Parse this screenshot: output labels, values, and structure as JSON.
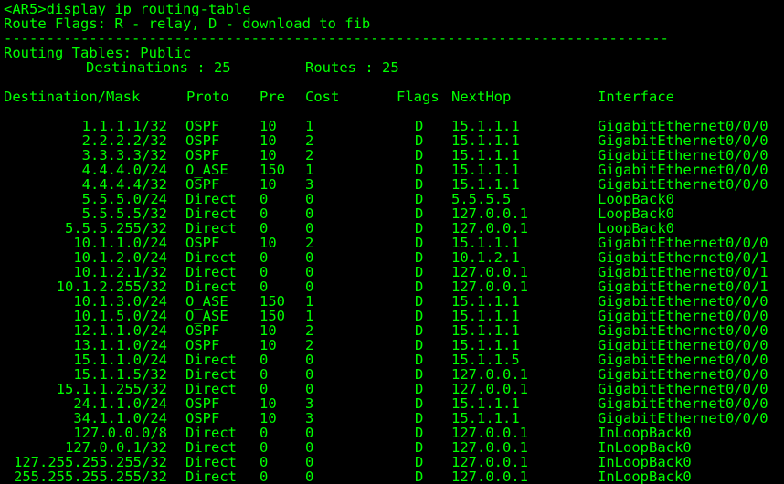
{
  "theme": {
    "background": "#000000",
    "text_color": "#00ff00"
  },
  "terminal": {
    "prompt_command": "<AR5>display ip routing-table",
    "flags_legend": "Route Flags: R - relay, D - download to fib",
    "separator": "------------------------------------------------------------------------------",
    "routing_tables_label": "Routing Tables: Public",
    "destinations_label": "Destinations : 25",
    "routes_label": "Routes : 25",
    "headers": {
      "destination": "Destination/Mask",
      "proto": "Proto",
      "pre": "Pre",
      "cost": "Cost",
      "flags": "Flags",
      "nexthop": "NextHop",
      "interface": "Interface"
    },
    "rows": [
      {
        "dest": "1.1.1.1/32",
        "proto": "OSPF",
        "pre": "10",
        "cost": "1",
        "flags": "D",
        "nexthop": "15.1.1.1",
        "iface": "GigabitEthernet0/0/0"
      },
      {
        "dest": "2.2.2.2/32",
        "proto": "OSPF",
        "pre": "10",
        "cost": "2",
        "flags": "D",
        "nexthop": "15.1.1.1",
        "iface": "GigabitEthernet0/0/0"
      },
      {
        "dest": "3.3.3.3/32",
        "proto": "OSPF",
        "pre": "10",
        "cost": "2",
        "flags": "D",
        "nexthop": "15.1.1.1",
        "iface": "GigabitEthernet0/0/0"
      },
      {
        "dest": "4.4.4.0/24",
        "proto": "O_ASE",
        "pre": "150",
        "cost": "1",
        "flags": "D",
        "nexthop": "15.1.1.1",
        "iface": "GigabitEthernet0/0/0"
      },
      {
        "dest": "4.4.4.4/32",
        "proto": "OSPF",
        "pre": "10",
        "cost": "3",
        "flags": "D",
        "nexthop": "15.1.1.1",
        "iface": "GigabitEthernet0/0/0"
      },
      {
        "dest": "5.5.5.0/24",
        "proto": "Direct",
        "pre": "0",
        "cost": "0",
        "flags": "D",
        "nexthop": "5.5.5.5",
        "iface": "LoopBack0"
      },
      {
        "dest": "5.5.5.5/32",
        "proto": "Direct",
        "pre": "0",
        "cost": "0",
        "flags": "D",
        "nexthop": "127.0.0.1",
        "iface": "LoopBack0"
      },
      {
        "dest": "5.5.5.255/32",
        "proto": "Direct",
        "pre": "0",
        "cost": "0",
        "flags": "D",
        "nexthop": "127.0.0.1",
        "iface": "LoopBack0"
      },
      {
        "dest": "10.1.1.0/24",
        "proto": "OSPF",
        "pre": "10",
        "cost": "2",
        "flags": "D",
        "nexthop": "15.1.1.1",
        "iface": "GigabitEthernet0/0/0"
      },
      {
        "dest": "10.1.2.0/24",
        "proto": "Direct",
        "pre": "0",
        "cost": "0",
        "flags": "D",
        "nexthop": "10.1.2.1",
        "iface": "GigabitEthernet0/0/1"
      },
      {
        "dest": "10.1.2.1/32",
        "proto": "Direct",
        "pre": "0",
        "cost": "0",
        "flags": "D",
        "nexthop": "127.0.0.1",
        "iface": "GigabitEthernet0/0/1"
      },
      {
        "dest": "10.1.2.255/32",
        "proto": "Direct",
        "pre": "0",
        "cost": "0",
        "flags": "D",
        "nexthop": "127.0.0.1",
        "iface": "GigabitEthernet0/0/1"
      },
      {
        "dest": "10.1.3.0/24",
        "proto": "O_ASE",
        "pre": "150",
        "cost": "1",
        "flags": "D",
        "nexthop": "15.1.1.1",
        "iface": "GigabitEthernet0/0/0"
      },
      {
        "dest": "10.1.5.0/24",
        "proto": "O_ASE",
        "pre": "150",
        "cost": "1",
        "flags": "D",
        "nexthop": "15.1.1.1",
        "iface": "GigabitEthernet0/0/0"
      },
      {
        "dest": "12.1.1.0/24",
        "proto": "OSPF",
        "pre": "10",
        "cost": "2",
        "flags": "D",
        "nexthop": "15.1.1.1",
        "iface": "GigabitEthernet0/0/0"
      },
      {
        "dest": "13.1.1.0/24",
        "proto": "OSPF",
        "pre": "10",
        "cost": "2",
        "flags": "D",
        "nexthop": "15.1.1.1",
        "iface": "GigabitEthernet0/0/0"
      },
      {
        "dest": "15.1.1.0/24",
        "proto": "Direct",
        "pre": "0",
        "cost": "0",
        "flags": "D",
        "nexthop": "15.1.1.5",
        "iface": "GigabitEthernet0/0/0"
      },
      {
        "dest": "15.1.1.5/32",
        "proto": "Direct",
        "pre": "0",
        "cost": "0",
        "flags": "D",
        "nexthop": "127.0.0.1",
        "iface": "GigabitEthernet0/0/0"
      },
      {
        "dest": "15.1.1.255/32",
        "proto": "Direct",
        "pre": "0",
        "cost": "0",
        "flags": "D",
        "nexthop": "127.0.0.1",
        "iface": "GigabitEthernet0/0/0"
      },
      {
        "dest": "24.1.1.0/24",
        "proto": "OSPF",
        "pre": "10",
        "cost": "3",
        "flags": "D",
        "nexthop": "15.1.1.1",
        "iface": "GigabitEthernet0/0/0"
      },
      {
        "dest": "34.1.1.0/24",
        "proto": "OSPF",
        "pre": "10",
        "cost": "3",
        "flags": "D",
        "nexthop": "15.1.1.1",
        "iface": "GigabitEthernet0/0/0"
      },
      {
        "dest": "127.0.0.0/8",
        "proto": "Direct",
        "pre": "0",
        "cost": "0",
        "flags": "D",
        "nexthop": "127.0.0.1",
        "iface": "InLoopBack0"
      },
      {
        "dest": "127.0.0.1/32",
        "proto": "Direct",
        "pre": "0",
        "cost": "0",
        "flags": "D",
        "nexthop": "127.0.0.1",
        "iface": "InLoopBack0"
      },
      {
        "dest": "127.255.255.255/32",
        "proto": "Direct",
        "pre": "0",
        "cost": "0",
        "flags": "D",
        "nexthop": "127.0.0.1",
        "iface": "InLoopBack0"
      },
      {
        "dest": "255.255.255.255/32",
        "proto": "Direct",
        "pre": "0",
        "cost": "0",
        "flags": "D",
        "nexthop": "127.0.0.1",
        "iface": "InLoopBack0"
      }
    ]
  }
}
